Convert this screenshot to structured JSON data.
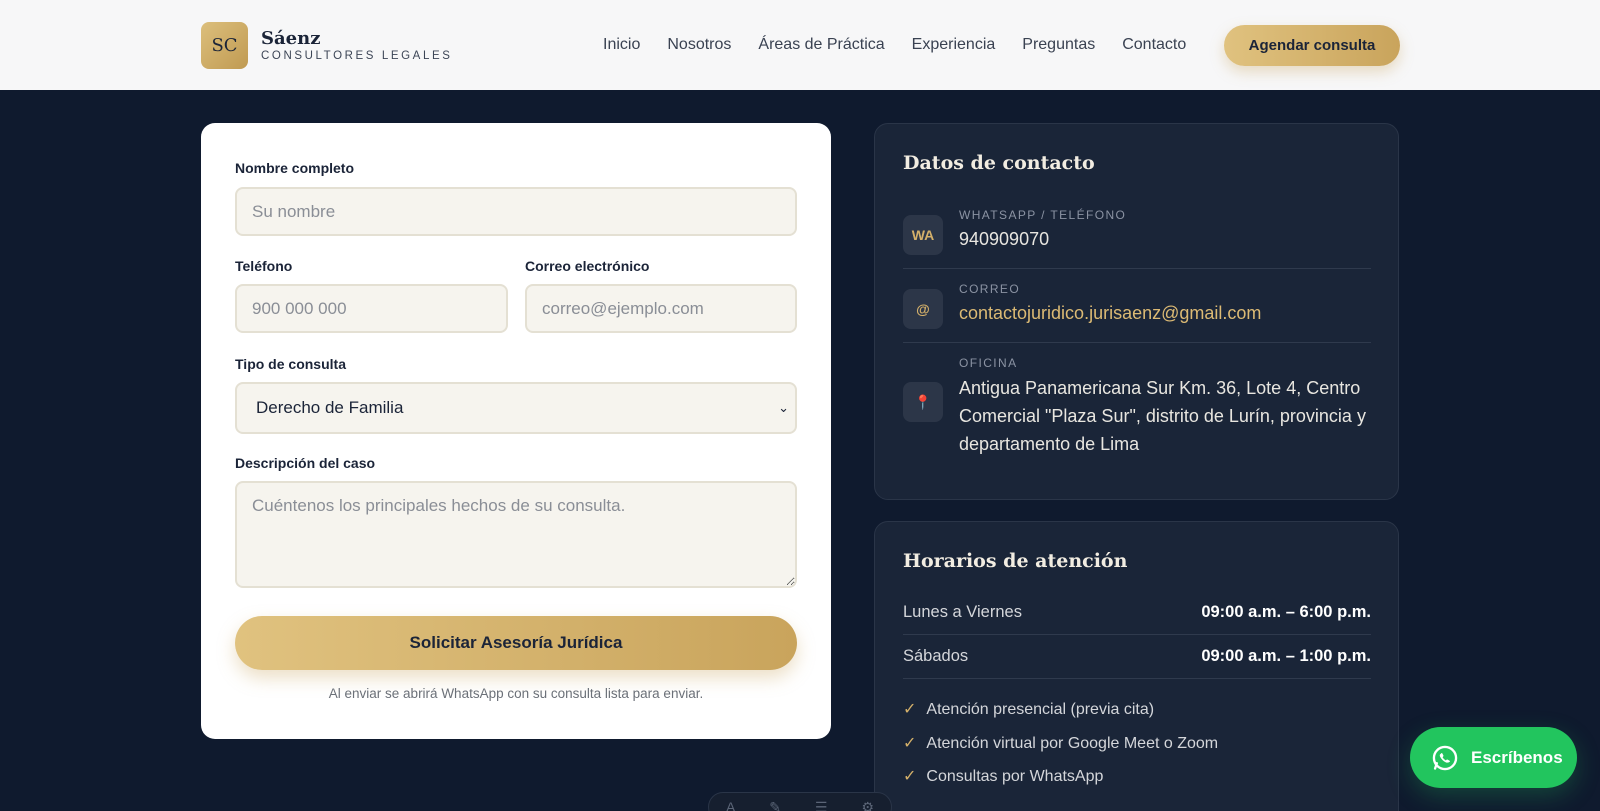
{
  "brand": {
    "logo": "SC",
    "name": "Sáenz",
    "subtitle": "CONSULTORES LEGALES"
  },
  "nav": {
    "links": [
      "Inicio",
      "Nosotros",
      "Áreas de Práctica",
      "Experiencia",
      "Preguntas",
      "Contacto"
    ],
    "cta": "Agendar consulta"
  },
  "form": {
    "name_label": "Nombre completo",
    "name_placeholder": "Su nombre",
    "phone_label": "Teléfono",
    "phone_placeholder": "900 000 000",
    "email_label": "Correo electrónico",
    "email_placeholder": "correo@ejemplo.com",
    "type_label": "Tipo de consulta",
    "type_value": "Derecho de Familia",
    "desc_label": "Descripción del caso",
    "desc_placeholder": "Cuéntenos los principales hechos de su consulta.",
    "submit": "Solicitar Asesoría Jurídica",
    "note": "Al enviar se abrirá WhatsApp con su consulta lista para enviar."
  },
  "contact": {
    "title": "Datos de contacto",
    "items": [
      {
        "icon": "WA",
        "label": "WHATSAPP / TELÉFONO",
        "value": "940909070"
      },
      {
        "icon": "@",
        "label": "CORREO",
        "value": "contactojuridico.jurisaenz@gmail.com"
      },
      {
        "icon": "📍",
        "label": "OFICINA",
        "value": "Antigua Panamericana Sur Km. 36, Lote 4, Centro Comercial \"Plaza Sur\", distrito de Lurín, provincia y departamento de Lima"
      }
    ]
  },
  "hours": {
    "title": "Horarios de atención",
    "rows": [
      {
        "day": "Lunes a Viernes",
        "time": "09:00 a.m. – 6:00 p.m."
      },
      {
        "day": "Sábados",
        "time": "09:00 a.m. – 1:00 p.m."
      }
    ],
    "features": [
      "Atención presencial (previa cita)",
      "Atención virtual por Google Meet o Zoom",
      "Consultas por WhatsApp"
    ]
  },
  "whatsapp_button": "Escríbenos",
  "colors": {
    "navy": "#0f1a2e",
    "gold": "#d4b06a",
    "whatsapp": "#22c55e"
  }
}
